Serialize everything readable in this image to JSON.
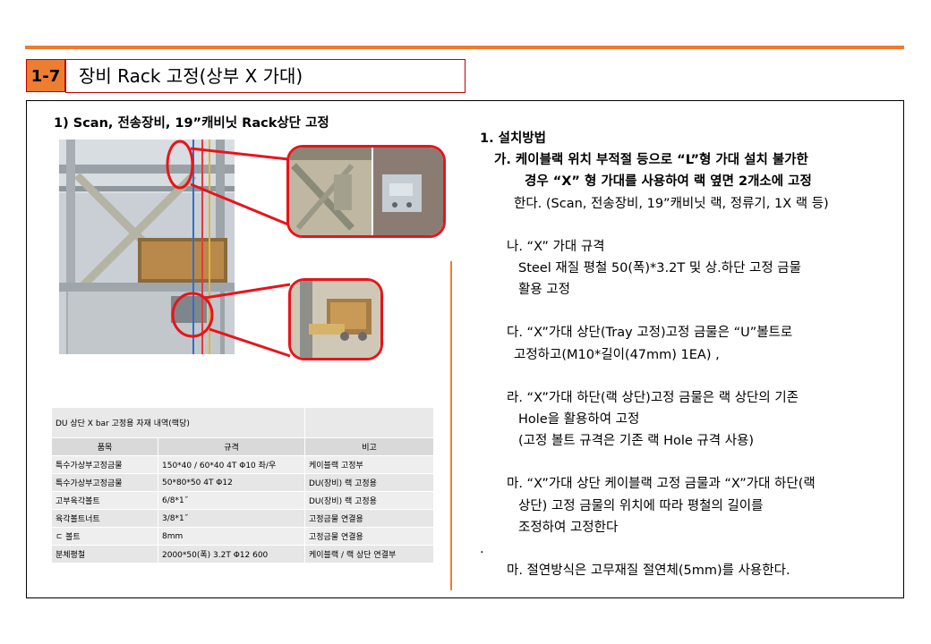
{
  "header": {
    "section_number": "1-7",
    "section_title": "장비 Rack 고정(상부 X 가대)"
  },
  "left": {
    "sub_heading": "1) Scan, 전송장비, 19”캐비닛 Rack상단 고정",
    "table": {
      "title": "DU 상단 X bar 고정용 자재 내역(랙당)",
      "headers": [
        "품목",
        "규격",
        "비고"
      ],
      "rows": [
        [
          "특수가상부고정금물",
          "150*40 / 60*40 4T Φ10 좌/우",
          "케이블랙 고정부"
        ],
        [
          "특수가상부고정금물",
          "50*80*50 4T Φ12",
          "DU(장비) 랙 고정용"
        ],
        [
          "고부육각볼트",
          "6/8*1˝",
          "DU(장비) 랙 고정용"
        ],
        [
          "육각볼트너트",
          "3/8*1˝",
          "고정금물 연결용"
        ],
        [
          "ㄷ 볼트",
          "8mm",
          "고정금물 연결용"
        ],
        [
          "분체평철",
          "2000*50(폭) 3.2T Φ12 600",
          "케이블랙 / 랙 상단 연결부"
        ]
      ]
    }
  },
  "right": {
    "heading": "1. 설치방법",
    "ga_1": "가. 케이블랙 위치 부적절 등으로 “L”형 가대 설치 불가한",
    "ga_2": "경우 “X” 형 가대를 사용하여 랙 옆면 2개소에 고정",
    "ga_3": "한다. (Scan, 전송장비, 19”캐비닛 랙, 정류기, 1X 랙 등)",
    "na_1": "나. “X” 가대 규격",
    "na_2": "Steel 재질 평철 50(폭)*3.2T 및 상.하단 고정 금물",
    "na_3": "활용 고정",
    "da_1": "다. “X”가대 상단(Tray 고정)고정 금물은 “U”볼트로",
    "da_2": "고정하고(M10*길이(47mm) 1EA) ,",
    "ra_1": "라. “X”가대 하단(랙 상단)고정 금물은 랙 상단의 기존",
    "ra_2": "Hole을 활용하여 고정",
    "ra_3": "(고정 볼트 규격은 기존 랙 Hole 규격 사용)",
    "ma_1": "마. “X”가대 상단 케이블랙 고정 금물과 “X”가대 하단(랙",
    "ma_2": "상단) 고정 금물의 위치에 따라 평철의 길이를",
    "ma_3": "조정하여 고정한다",
    "dot": ".",
    "ma2_1": "마. 절연방식은 고무재질 절연체(5mm)를 사용한다."
  },
  "colors": {
    "accent": "#ed7d31",
    "frame": "#c00000",
    "callout": "#e8141b"
  }
}
